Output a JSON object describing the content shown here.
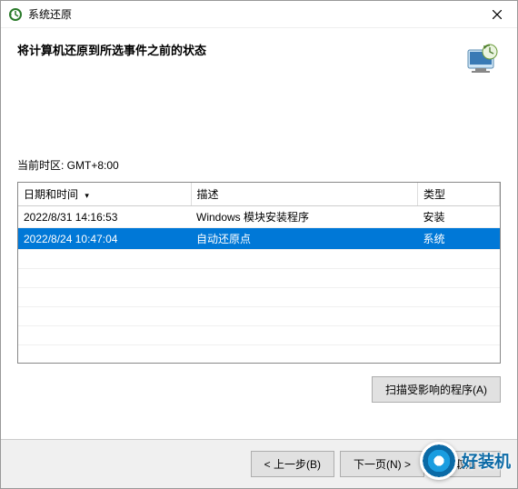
{
  "titlebar": {
    "title": "系统还原"
  },
  "header": {
    "heading": "将计算机还原到所选事件之前的状态"
  },
  "timezone": {
    "label": "当前时区: GMT+8:00"
  },
  "table": {
    "columns": {
      "date": "日期和时间",
      "desc": "描述",
      "type": "类型"
    },
    "rows": [
      {
        "date": "2022/8/31 14:16:53",
        "desc": "Windows 模块安装程序",
        "type": "安装",
        "selected": false
      },
      {
        "date": "2022/8/24 10:47:04",
        "desc": "自动还原点",
        "type": "系统",
        "selected": true
      }
    ]
  },
  "buttons": {
    "scan": "扫描受影响的程序(A)",
    "back": "< 上一步(B)",
    "next": "下一页(N) >",
    "cancel": "取消"
  },
  "watermark": {
    "text": "好装机"
  }
}
